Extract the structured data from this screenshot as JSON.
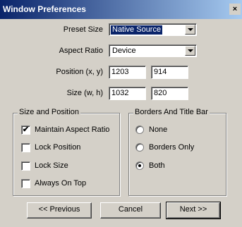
{
  "window": {
    "title": "Window Preferences",
    "close_label": "×"
  },
  "preset": {
    "label": "Preset Size",
    "value": "Native Source"
  },
  "aspect": {
    "label": "Aspect Ratio",
    "value": "Device"
  },
  "position": {
    "label": "Position (x, y)",
    "x": "1203",
    "y": "914"
  },
  "size": {
    "label": "Size (w, h)",
    "w": "1032",
    "h": "820"
  },
  "size_group": {
    "title": "Size and Position",
    "options": [
      {
        "label": "Maintain Aspect Ratio",
        "checked": true,
        "mark": "✔"
      },
      {
        "label": "Lock Position",
        "checked": false,
        "mark": ""
      },
      {
        "label": "Lock Size",
        "checked": false,
        "mark": ""
      },
      {
        "label": "Always On Top",
        "checked": false,
        "mark": ""
      }
    ]
  },
  "borders_group": {
    "title": "Borders And Title Bar",
    "options": [
      {
        "label": "None",
        "selected": false
      },
      {
        "label": "Borders Only",
        "selected": false
      },
      {
        "label": "Both",
        "selected": true
      }
    ]
  },
  "buttons": {
    "previous": "<< Previous",
    "cancel": "Cancel",
    "next": "Next >>"
  }
}
